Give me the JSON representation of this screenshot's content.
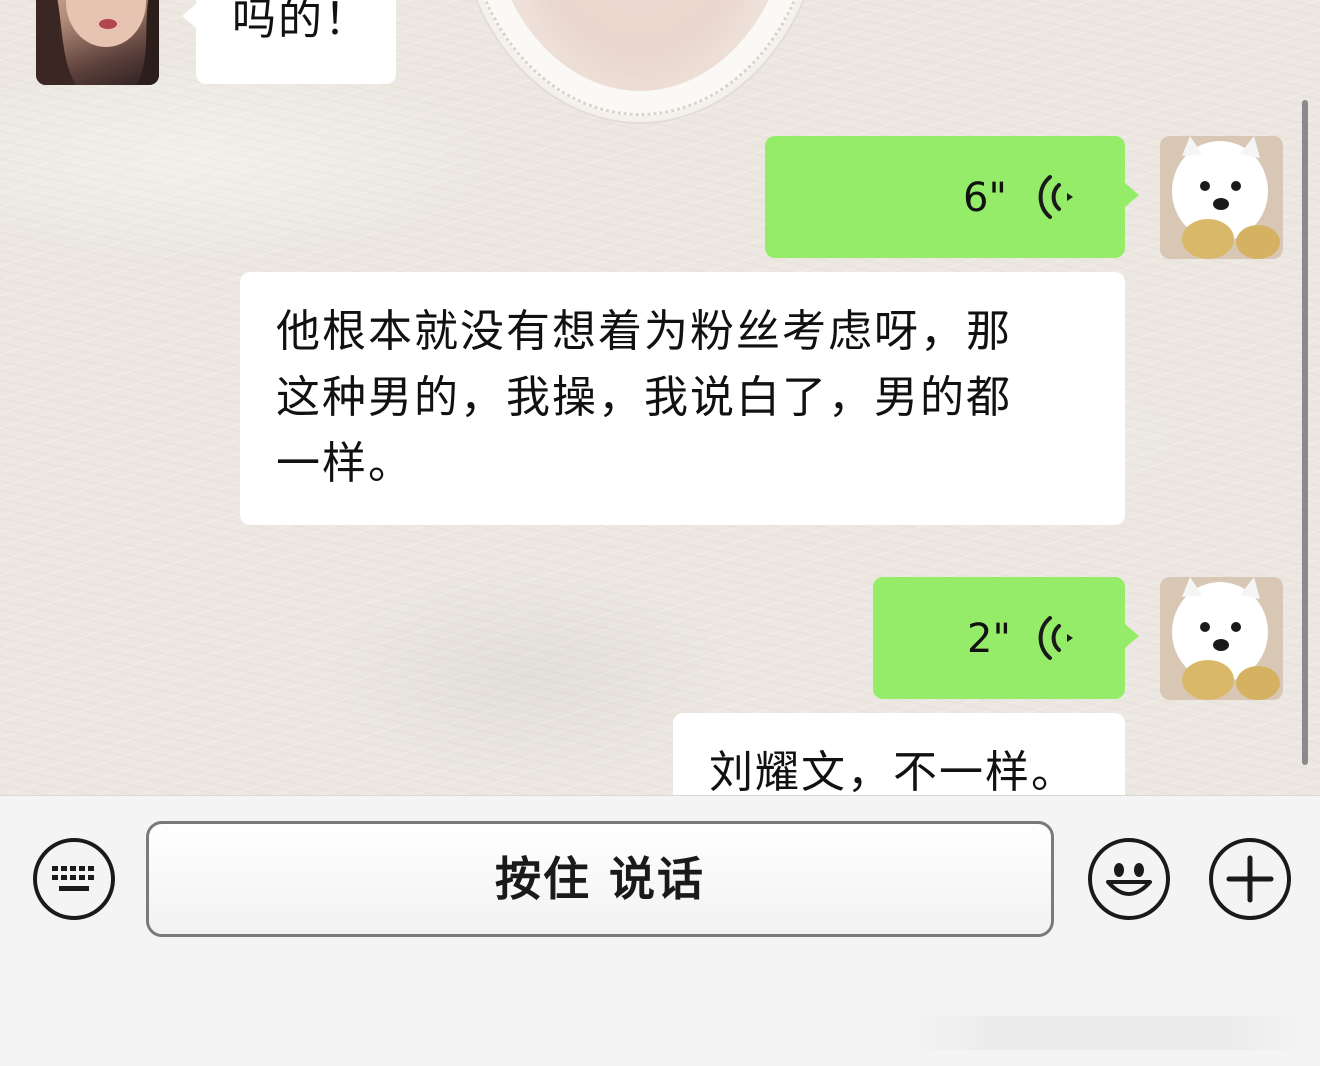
{
  "chat": {
    "messages": [
      {
        "side": "left",
        "type": "text",
        "text": "吗的！"
      },
      {
        "side": "right",
        "type": "voice",
        "duration": "6\""
      },
      {
        "side": "left",
        "type": "text",
        "lines": [
          "他根本就没有想着为粉丝考虑呀，那",
          "这种男的，我操，我说白了，男的都",
          "一样。"
        ]
      },
      {
        "side": "right",
        "type": "voice",
        "duration": "2\""
      },
      {
        "side": "left",
        "type": "text",
        "text": "刘耀文，不一样。"
      }
    ]
  },
  "input_bar": {
    "hold_to_talk_label": "按住 说话",
    "keyboard_icon": "keyboard-icon",
    "emoji_icon": "smiley-face-icon",
    "more_icon": "plus-icon"
  },
  "colors": {
    "sent_bubble": "#95ec69",
    "received_bubble": "#ffffff",
    "input_bar_bg": "#f4f4f4"
  }
}
